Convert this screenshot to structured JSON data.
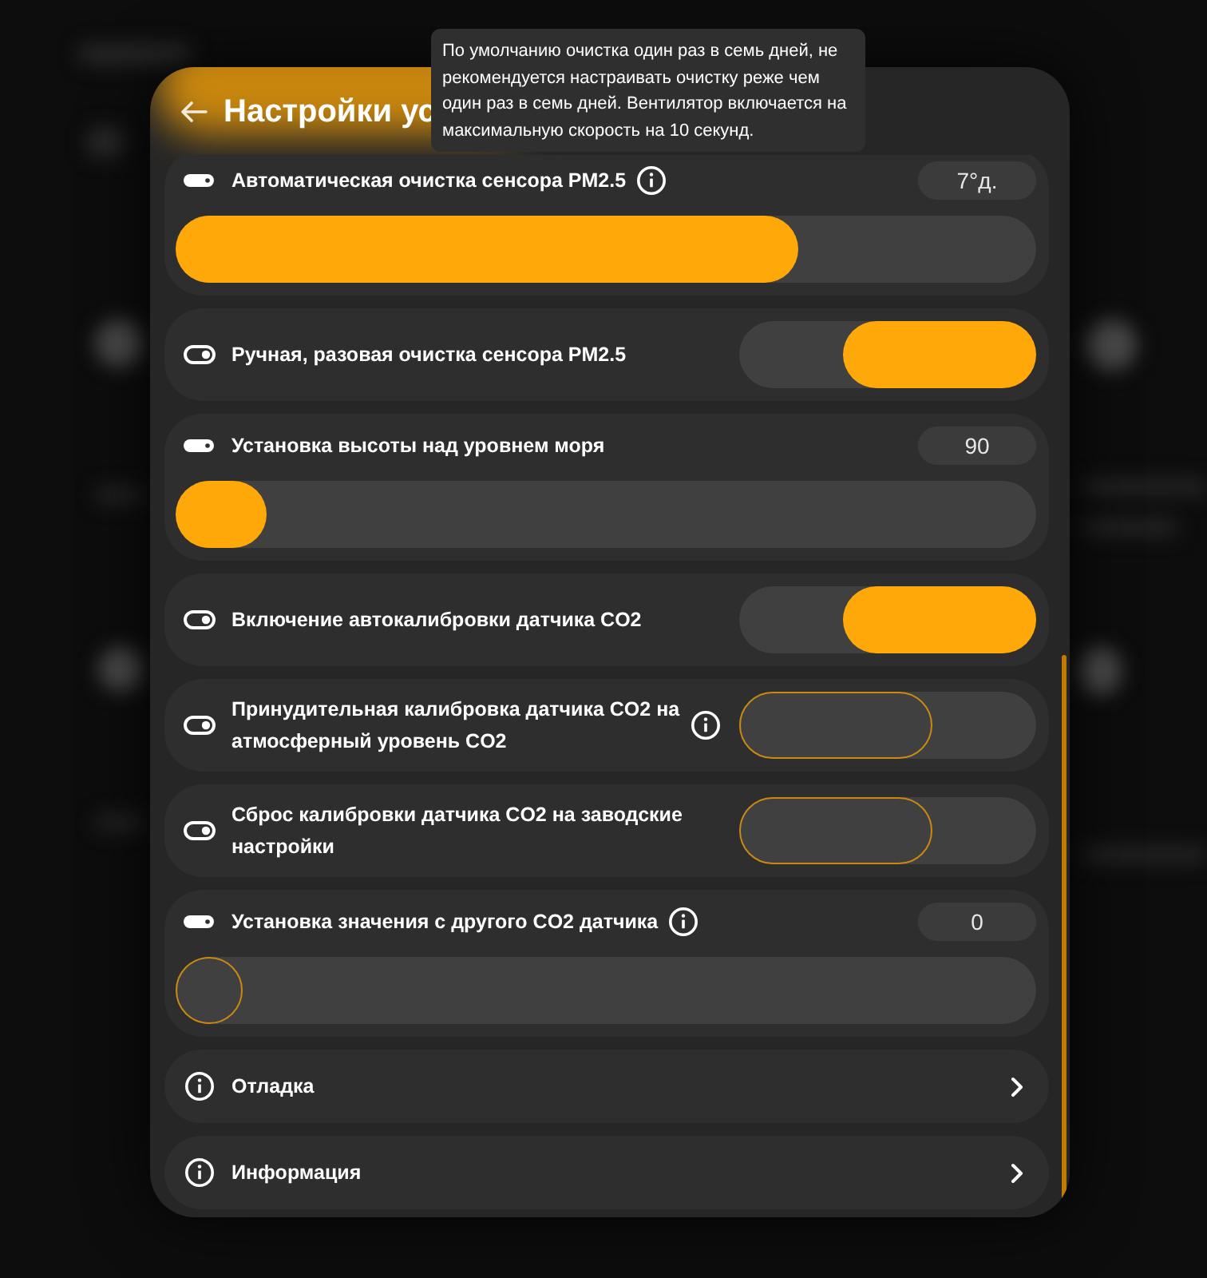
{
  "header": {
    "title": "Настройки ус"
  },
  "tooltip": {
    "text": "По умолчанию очистка один раз в семь дней, не рекомендуется настраивать очистку реже чем один раз в семь дней. Вентилятор включается на максимальную скорость на 10 секунд."
  },
  "settings": [
    {
      "kind": "slider",
      "label": "Автоматическая очистка сенсора PM2.5",
      "info": true,
      "value": "7°д.",
      "level": 0.7
    },
    {
      "kind": "switch",
      "label": "Ручная, разовая очистка сенсора PM2.5",
      "info": false,
      "on": true
    },
    {
      "kind": "slider",
      "label": "Установка высоты над уровнем моря",
      "info": false,
      "value": "90",
      "level": 0.03
    },
    {
      "kind": "switch",
      "label": "Включение автокалибровки датчика CO2",
      "info": false,
      "on": true
    },
    {
      "kind": "switch",
      "label": "Принудительная калибровка датчика CO2 на атмосферный уровень CO2",
      "info": true,
      "on": false
    },
    {
      "kind": "switch",
      "label": "Сброс калибровки датчика CO2 на заводские настройки",
      "info": false,
      "on": false
    },
    {
      "kind": "slider",
      "label": "Установка значения с другого CO2 датчика",
      "info": true,
      "value": "0",
      "level": 0
    },
    {
      "kind": "link",
      "label": "Отладка"
    },
    {
      "kind": "link",
      "label": "Информация"
    }
  ]
}
